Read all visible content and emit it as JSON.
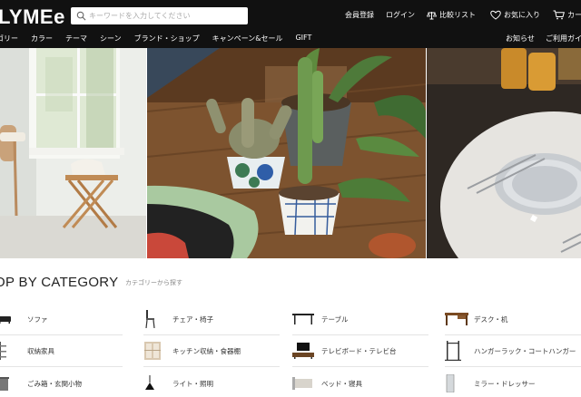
{
  "header": {
    "logo": "LYMEe",
    "search_placeholder": "キーワードを入力してください",
    "nav": {
      "register": "会員登録",
      "login": "ログイン",
      "compare": "比較リスト",
      "favorites": "お気に入り",
      "cart": "カー"
    },
    "categories": [
      "ゴリー",
      "カラー",
      "テーマ",
      "シーン",
      "ブランド・ショップ",
      "キャンペーン&セール",
      "GIFT"
    ],
    "right_links": {
      "news": "お知らせ",
      "guide": "ご利用ガイ"
    }
  },
  "hero": {
    "panels": [
      "interior-room-chair",
      "cactus-plants-rug",
      "dining-table-plates"
    ]
  },
  "category_section": {
    "title": "OP BY CATEGORY",
    "subtitle": "カテゴリーから探す",
    "items": [
      {
        "label": "ソファ",
        "icon": "sofa-icon"
      },
      {
        "label": "チェア・椅子",
        "icon": "chair-icon"
      },
      {
        "label": "テーブル",
        "icon": "table-icon"
      },
      {
        "label": "デスク・机",
        "icon": "desk-icon"
      },
      {
        "label": "収納家具",
        "icon": "shelf-icon"
      },
      {
        "label": "キッチン収納・食器棚",
        "icon": "cupboard-icon"
      },
      {
        "label": "テレビボード・テレビ台",
        "icon": "tv-board-icon"
      },
      {
        "label": "ハンガーラック・コートハンガー",
        "icon": "hanger-rack-icon"
      },
      {
        "label": "ごみ箱・玄関小物",
        "icon": "trash-can-icon"
      },
      {
        "label": "ライト・照明",
        "icon": "pendant-light-icon"
      },
      {
        "label": "ベッド・寝具",
        "icon": "bed-icon"
      },
      {
        "label": "ミラー・ドレッサー",
        "icon": "mirror-icon"
      }
    ]
  },
  "colors": {
    "header_bg": "#111111",
    "header_text": "#ffffff",
    "page_bg": "#ffffff"
  }
}
